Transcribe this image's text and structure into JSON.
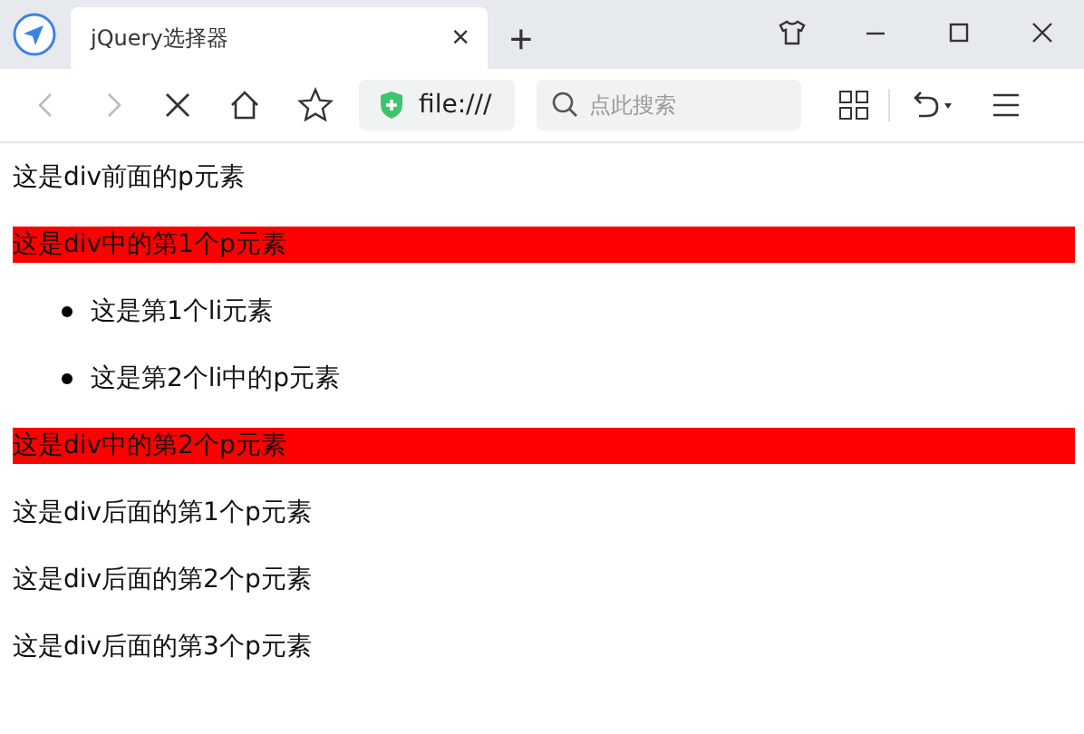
{
  "tab": {
    "title": "jQuery选择器",
    "close": "×"
  },
  "new_tab": "+",
  "address": {
    "url": "file:///"
  },
  "search": {
    "placeholder": "点此搜索"
  },
  "content": [
    {
      "kind": "p",
      "text": "这是div前面的p元素",
      "highlighted": false
    },
    {
      "kind": "p",
      "text": "这是div中的第1个p元素",
      "highlighted": true
    },
    {
      "kind": "li",
      "text": "这是第1个li元素",
      "highlighted": false
    },
    {
      "kind": "li",
      "text": "这是第2个li中的p元素",
      "highlighted": false
    },
    {
      "kind": "p",
      "text": "这是div中的第2个p元素",
      "highlighted": true
    },
    {
      "kind": "p",
      "text": "这是div后面的第1个p元素",
      "highlighted": false
    },
    {
      "kind": "p",
      "text": "这是div后面的第2个p元素",
      "highlighted": false
    },
    {
      "kind": "p",
      "text": "这是div后面的第3个p元素",
      "highlighted": false
    }
  ]
}
